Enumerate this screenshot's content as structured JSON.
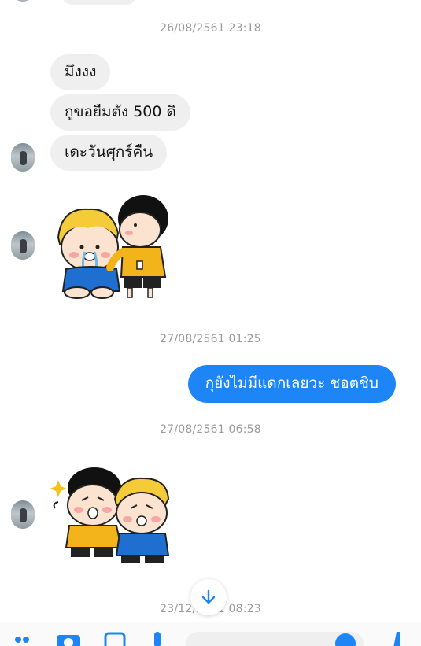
{
  "conversation": {
    "timestamps": [
      "26/08/2561 23:18",
      "27/08/2561 01:25",
      "27/08/2561 06:58",
      "23/12/2561 08:23"
    ],
    "incoming": [
      "มึงงง",
      "กูขอยืมตัง 500 ดิ",
      "เดะวันศุกร์คืน"
    ],
    "outgoing": [
      "กุยังไม่มีแดกเลยวะ ชอตชิบ"
    ]
  },
  "colors": {
    "accent": "#1e85f7",
    "incoming_bubble": "#efefef",
    "timestamp_text": "#9a9a9a"
  },
  "icons": {
    "scroll_down": "arrow-down-icon",
    "toolbar": [
      "more-icon",
      "camera-icon",
      "gallery-icon",
      "mic-icon",
      "emoji-icon",
      "like-icon"
    ]
  }
}
